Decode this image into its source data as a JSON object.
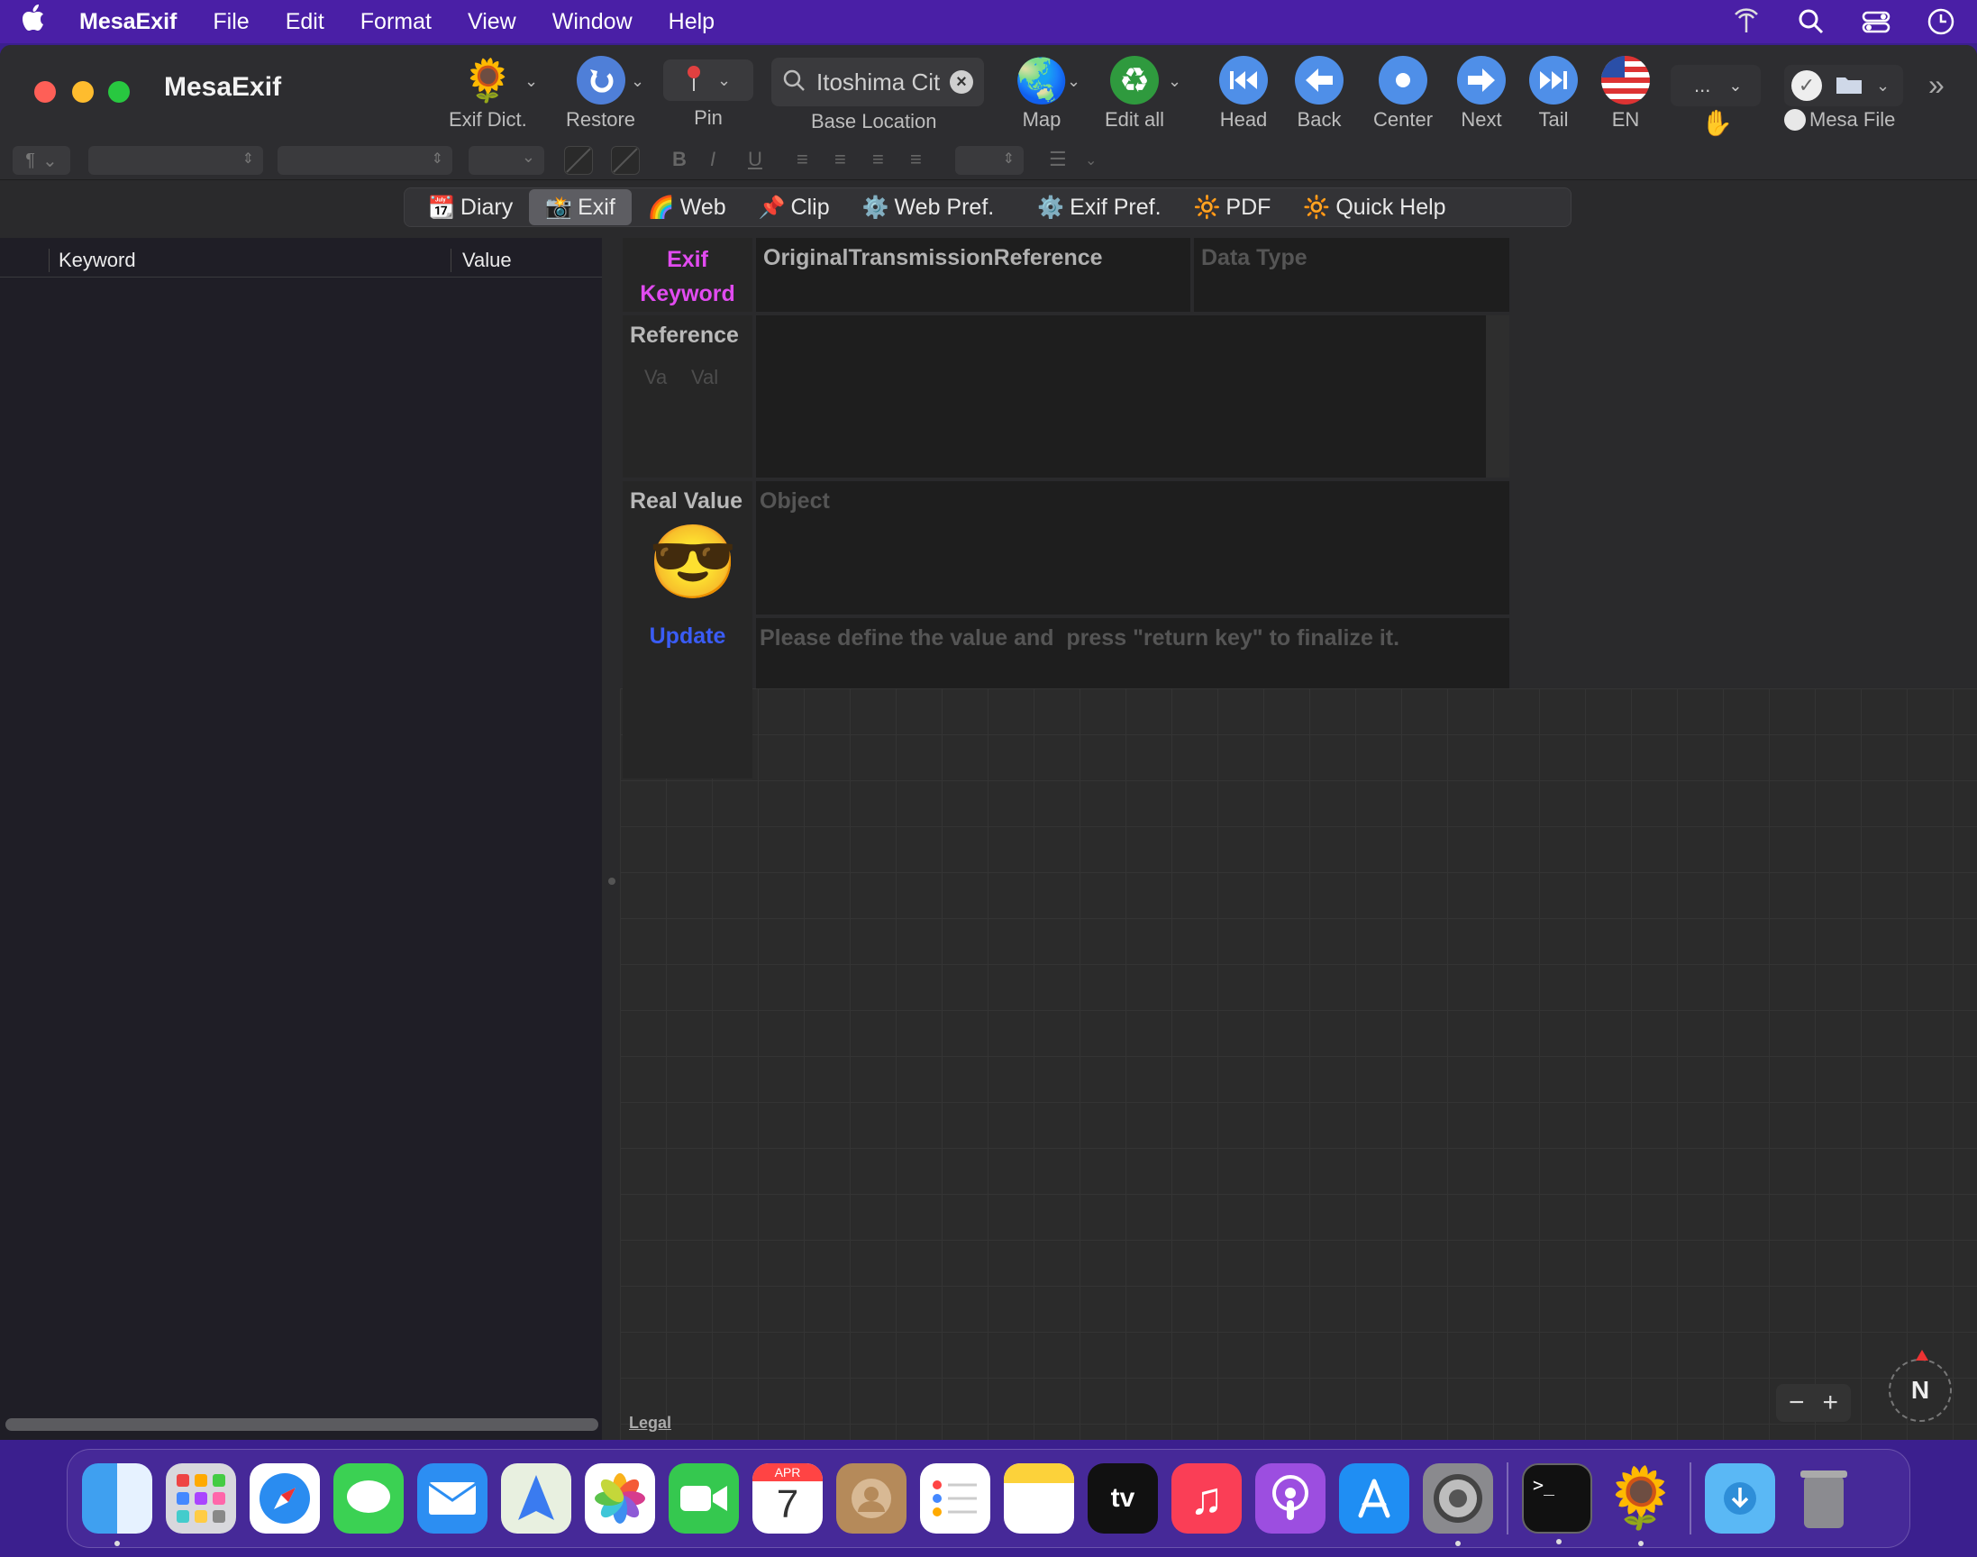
{
  "menubar": {
    "app_name": "MesaExif",
    "items": [
      "File",
      "Edit",
      "Format",
      "View",
      "Window",
      "Help"
    ]
  },
  "window": {
    "title": "MesaExif"
  },
  "toolbar": {
    "exif_dict": "Exif Dict.",
    "restore": "Restore",
    "pin": "Pin",
    "search_value": "Itoshima Cit",
    "base_location": "Base Location",
    "map": "Map",
    "edit_all": "Edit all",
    "head": "Head",
    "back": "Back",
    "center": "Center",
    "next": "Next",
    "tail": "Tail",
    "language": "EN",
    "more_popup": "...",
    "mesa_file": "Mesa File"
  },
  "formatbar": {
    "paragraph": "¶",
    "bold": "B",
    "italic": "I",
    "underline": "U",
    "list": "☰"
  },
  "tabs": [
    {
      "icon": "📆",
      "label": "Diary"
    },
    {
      "icon": "📸",
      "label": "Exif"
    },
    {
      "icon": "🌈",
      "label": "Web"
    },
    {
      "icon": "📌",
      "label": "Clip"
    },
    {
      "icon": "⚙️",
      "label": "Web Pref."
    },
    {
      "icon": "⚙️",
      "label": "Exif Pref."
    },
    {
      "icon": "🔆",
      "label": "PDF"
    },
    {
      "icon": "🔆",
      "label": "Quick Help"
    }
  ],
  "table": {
    "col_keyword": "Keyword",
    "col_value": "Value"
  },
  "editor": {
    "exif_label": "Exif",
    "keyword_label": "Keyword",
    "keyword_value": "OriginalTransmissionReference",
    "data_type_placeholder": "Data Type",
    "reference_label": "Reference",
    "ref_col1": "Va",
    "ref_col2": "Val",
    "real_value_label": "Real Value",
    "emoji": "😎",
    "object_placeholder": "Object",
    "update_label": "Update",
    "hint_text": "Please define the value and  press \"return key\" to finalize it."
  },
  "map": {
    "legal": "Legal",
    "zoom_out": "−",
    "zoom_in": "+",
    "compass": "N"
  },
  "colors": {
    "keyword_pink": "#e14bf0",
    "update_blue": "#3a5cf5",
    "menubar": "#4a1fa6"
  }
}
